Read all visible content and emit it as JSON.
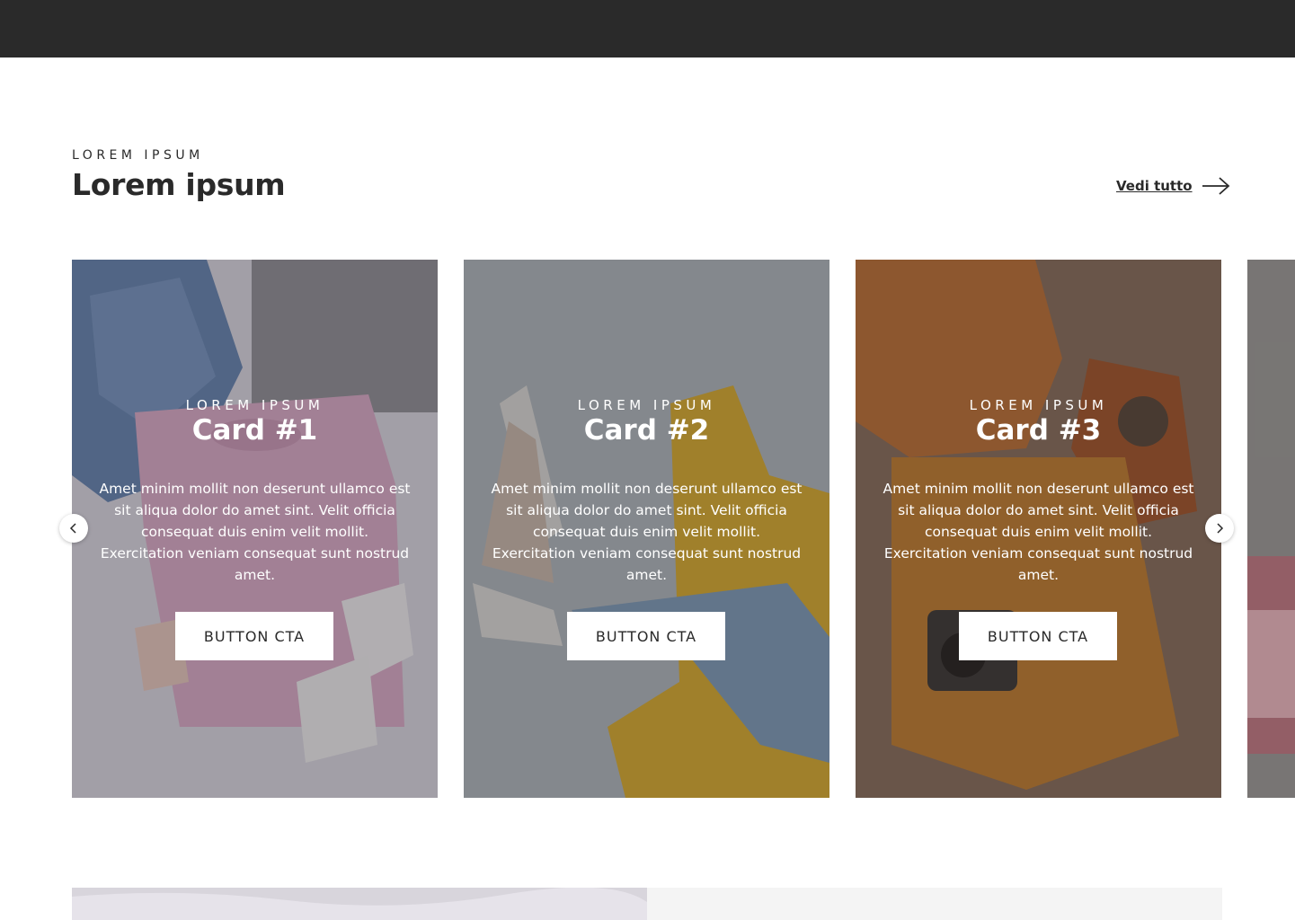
{
  "section": {
    "eyebrow": "LOREM IPSUM",
    "title": "Lorem ipsum",
    "view_all_label": "Vedi tutto"
  },
  "cards": [
    {
      "eyebrow": "LOREM IPSUM",
      "title": "Card #1",
      "text": "Amet minim mollit non deserunt ullamco est sit aliqua dolor do amet sint. Velit officia consequat duis enim velit mollit. Exercitation veniam consequat sunt nostrud amet.",
      "button_label": "BUTTON CTA"
    },
    {
      "eyebrow": "LOREM IPSUM",
      "title": "Card #2",
      "text": "Amet minim mollit non deserunt ullamco est sit aliqua dolor do amet sint. Velit officia consequat duis enim velit mollit. Exercitation veniam consequat sunt nostrud amet.",
      "button_label": "BUTTON CTA"
    },
    {
      "eyebrow": "LOREM IPSUM",
      "title": "Card #3",
      "text": "Amet minim mollit non deserunt ullamco est sit aliqua dolor do amet sint. Velit officia consequat duis enim velit mollit. Exercitation veniam consequat sunt nostrud amet.",
      "button_label": "BUTTON CTA"
    }
  ],
  "icons": {
    "prev": "chevron-left-icon",
    "next": "chevron-right-icon",
    "view_all": "arrow-right-icon"
  },
  "colors": {
    "topbar": "#2a2a2a",
    "text": "#2a2a2a",
    "bottom_panel": "#f4f4f4"
  }
}
